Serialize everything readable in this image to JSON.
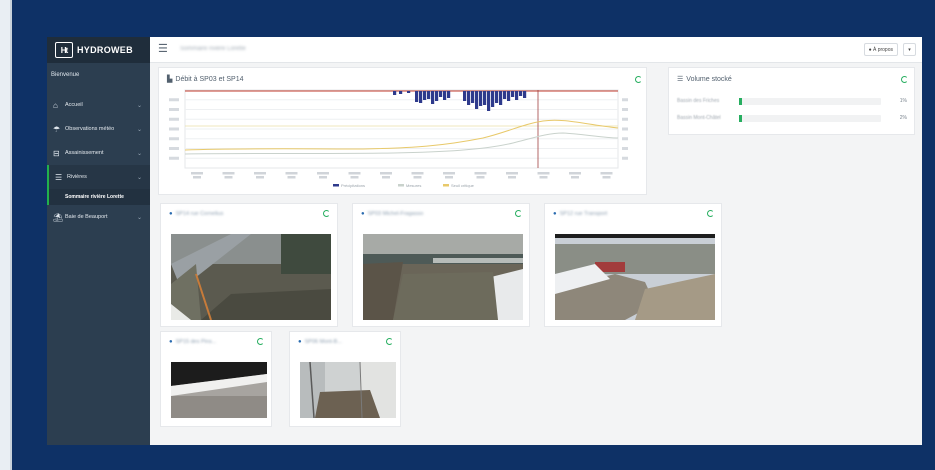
{
  "app": {
    "logo_text": "HYDROWEB",
    "logo_mark": "Ht"
  },
  "header": {
    "breadcrumb": "Sommaire rivière Lorette",
    "about_label": "À propos",
    "menu_caret": "▾"
  },
  "sidebar": {
    "welcome": "Bienvenue",
    "items": [
      {
        "label": "Accueil",
        "icon": "home-icon"
      },
      {
        "label": "Observations météo",
        "icon": "weather-icon"
      },
      {
        "label": "Assainissement",
        "icon": "sewer-icon"
      },
      {
        "label": "Rivières",
        "icon": "list-icon",
        "active": true
      },
      {
        "label": "Baie de Beauport",
        "icon": "beach-icon"
      }
    ],
    "subitem": "Sommaire rivière Lorette"
  },
  "flow_chart": {
    "title": "Débit à SP03 et SP14",
    "legend": [
      "Précipitations",
      "Mesures",
      "Seuil critique"
    ],
    "colors": {
      "precip": "#2e3a8c",
      "line1": "#e8c96a",
      "line2": "#c9d2cc",
      "threshold": "#c0392b",
      "marker": "#a04040"
    }
  },
  "volume": {
    "title": "Volume stocké",
    "rows": [
      {
        "label": "Bassin des Friches",
        "value": "1%",
        "fraction": 0.01
      },
      {
        "label": "Bassin Mont-Châtel",
        "value": "2%",
        "fraction": 0.02
      }
    ]
  },
  "cameras": [
    {
      "title": "SP14 rue Cornelius"
    },
    {
      "title": "SP03 Michel-Fragasso"
    },
    {
      "title": "SP12 rue Transport"
    },
    {
      "title": "SP15 des Pins..."
    },
    {
      "title": "SP06 Mont-B..."
    }
  ]
}
